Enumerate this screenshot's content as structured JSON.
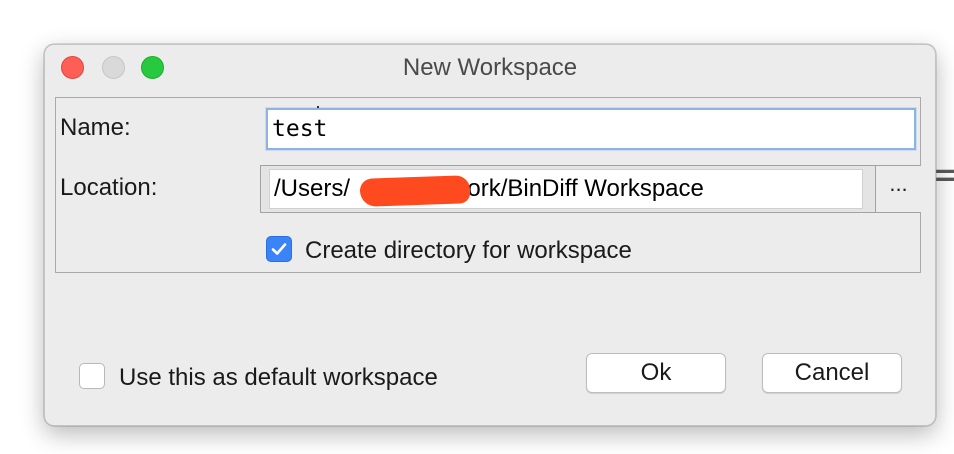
{
  "window": {
    "title": "New Workspace"
  },
  "form": {
    "name_label": "Name:",
    "name_value": "test",
    "location_label": "Location:",
    "location_value_prefix": "/Users/",
    "location_value_suffix": "work/BinDiff Workspace",
    "browse_label": "...",
    "create_dir_label": "Create directory for workspace",
    "create_dir_checked": true
  },
  "footer": {
    "default_label": "Use this as default workspace",
    "default_checked": false,
    "ok_label": "Ok",
    "cancel_label": "Cancel"
  },
  "colors": {
    "checkbox_accent": "#3a84f7",
    "redaction": "#ff4a1f",
    "close_light": "#fd5f57",
    "maximize_light": "#27c93f"
  }
}
